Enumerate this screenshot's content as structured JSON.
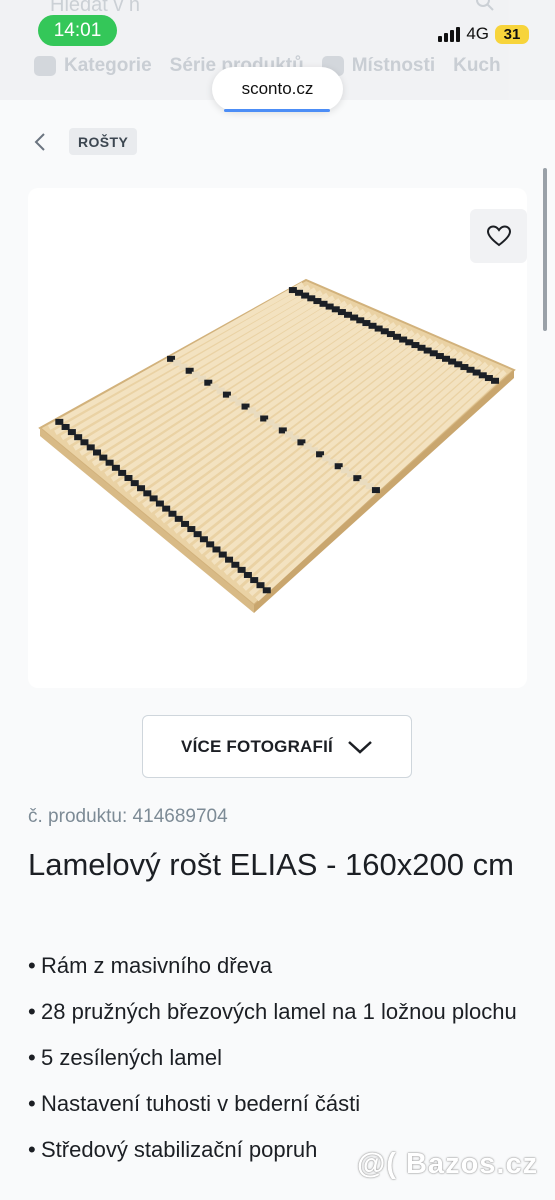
{
  "status_bar": {
    "time": "14:01",
    "network": "4G",
    "battery": "31"
  },
  "header": {
    "search_placeholder": "Hledat v n",
    "nav": [
      {
        "label": "Kategorie",
        "icon": "home-icon"
      },
      {
        "label": "Série produktů",
        "icon": ""
      },
      {
        "label": "Místnosti",
        "icon": "home-icon"
      },
      {
        "label": "Kuch",
        "icon": ""
      }
    ]
  },
  "browser": {
    "url": "sconto.cz"
  },
  "breadcrumb": {
    "label": "ROŠTY"
  },
  "product": {
    "more_photos": "VÍCE FOTOGRAFIÍ",
    "sku": "č. produktu: 414689704",
    "title": "Lamelový rošt ELIAS - 160x200 cm",
    "features": [
      "Rám z masivního dřeva",
      "28 pružných březových lamel na 1 ložnou plochu",
      "5 zesílených lamel",
      "Nastavení tuhosti v bederní části",
      "Středový stabilizační popruh"
    ]
  },
  "watermark": "@( Bazos.cz",
  "colors": {
    "time_pill": "#34c759",
    "battery": "#f7d43b",
    "url_accent": "#4c8df6",
    "sku": "#7d8b96"
  }
}
